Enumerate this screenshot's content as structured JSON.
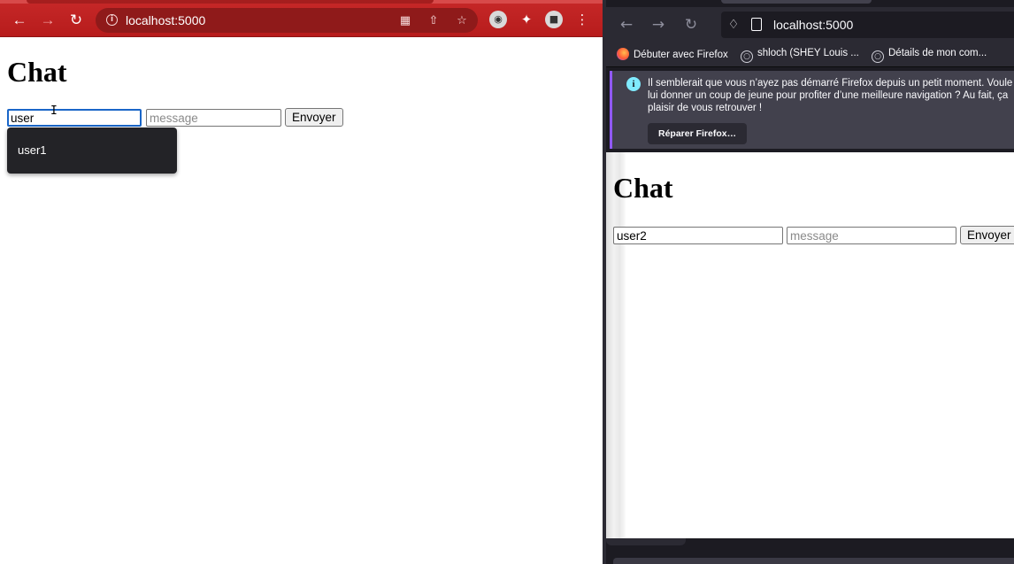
{
  "left_browser": {
    "url": "localhost:5000",
    "page": {
      "title": "Chat",
      "username_value": "user",
      "message_placeholder": "message",
      "send_label": "Envoyer",
      "autocomplete_options": [
        "user1"
      ]
    }
  },
  "right_browser": {
    "url": "localhost:5000",
    "bookmarks": [
      {
        "label": "Débuter avec Firefox",
        "icon": "firefox-icon"
      },
      {
        "label": "shloch (SHEY Louis ...",
        "icon": "globe-icon"
      },
      {
        "label": "Détails de mon com...",
        "icon": "globe-icon"
      }
    ],
    "notice": {
      "lines": [
        "Il semblerait que vous n’ayez pas démarré Firefox depuis un petit moment. Voule",
        "lui donner un coup de jeune pour profiter d’une meilleure navigation ? Au fait, ça",
        "plaisir de vous retrouver !"
      ],
      "button_label": "Réparer Firefox…"
    },
    "page": {
      "title": "Chat",
      "username_value": "user2",
      "message_placeholder": "message",
      "send_label": "Envoyer"
    }
  },
  "colors": {
    "chrome_theme": "#c62828",
    "firefox_toolbar": "#2b2a33",
    "focus_ring": "#1a66c8"
  }
}
